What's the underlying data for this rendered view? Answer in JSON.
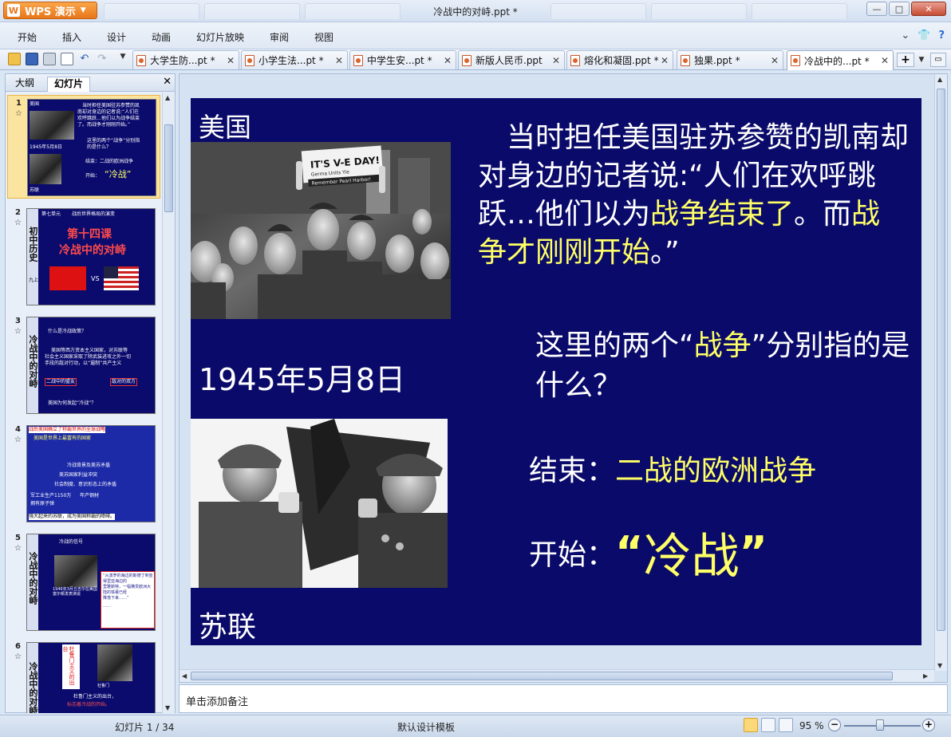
{
  "app": {
    "name": "WPS 演示",
    "window_title": "冷战中的对峙.ppt *",
    "controls": {
      "minimize": "—",
      "maximize": "□",
      "close": "✕"
    }
  },
  "menu": {
    "items": [
      "开始",
      "插入",
      "设计",
      "动画",
      "幻灯片放映",
      "审阅",
      "视图"
    ],
    "right_icons": [
      "chevron-down-icon",
      "shirt-icon",
      "help-icon"
    ]
  },
  "tabs": [
    {
      "label": "大学生防...pt *",
      "active": false
    },
    {
      "label": "小学生法...pt *",
      "active": false
    },
    {
      "label": "中学生安...pt *",
      "active": false
    },
    {
      "label": "新版人民币.ppt",
      "active": false
    },
    {
      "label": "熔化和凝固.ppt *",
      "active": false
    },
    {
      "label": "独果.ppt *",
      "active": false
    },
    {
      "label": "冷战中的...pt *",
      "active": true
    }
  ],
  "left_pane": {
    "tabs": [
      "大纲",
      "幻灯片"
    ],
    "active_tab": "幻灯片",
    "thumbnails": [
      {
        "num": "1",
        "lines": [
          "美国",
          "当时担任美国驻苏参赞的凯",
          "南却对身边的记者说:“人们在",
          "欢呼跳跃…他们以为战争结束",
          "了。而战争才刚刚开始。”",
          "1945年5月8日",
          "这里的两个“战争”分别指",
          "的是什么？",
          "结束：二战的欧洲战争",
          "开始：",
          "“冷战”",
          "苏联"
        ]
      },
      {
        "num": "2",
        "lines": [
          "初中历史",
          "第七单元",
          "战后世界格局的演变",
          "第十四课",
          "冷战中的对峙",
          "VS",
          "九上"
        ]
      },
      {
        "num": "3",
        "lines": [
          "冷战中的对峙",
          "什么是冷战政策？",
          "美国等西方资本主义国家，对苏联等",
          "社会主义国家采取了除武装进攻之外一切",
          "手段的敌对行动，以“遏制”共产主义",
          "二战中的盟友",
          "敌对的双方",
          "美国为何发起“冷战”？"
        ]
      },
      {
        "num": "4",
        "lines": [
          "战后美国确立了称霸世界的全球战略",
          "美国是世界上最富有的国家",
          "冷战背景及美苏矛盾",
          "美苏国家利益冲突",
          "社会制度、意识形态上的矛盾",
          "军工业生产1150万",
          "年产钢材",
          "拥有原子弹",
          "强大起来的苏联，成为美国称霸的障碍。"
        ]
      },
      {
        "num": "5",
        "lines": [
          "冷战中的对峙",
          "冷战的信号",
          "1946年3月丘吉尔在美国富尔顿发表演说",
          "“从波罗的海边的斯德丁到亚得里亚海边的",
          "里雅斯特，一幅横贯欧洲大陆的铁幕已经",
          "降落下来……”",
          "……"
        ]
      },
      {
        "num": "6",
        "lines": [
          "冷战中的对峙",
          "杜鲁门主义的出台",
          "杜鲁门",
          "杜鲁门主义的出台，",
          "标志着冷战的开始。"
        ]
      }
    ]
  },
  "slide": {
    "label_us": "美国",
    "quote_parts": [
      {
        "text": "　当时担任美国驻苏参赞的凯南却对身边的记者说:“人们在欢呼跳跃…他们以为",
        "hl": false
      },
      {
        "text": "战争结束了",
        "hl": true
      },
      {
        "text": "。而",
        "hl": false
      },
      {
        "text": "战争才刚刚开始",
        "hl": true
      },
      {
        "text": "。”",
        "hl": false
      }
    ],
    "date": "1945年5月8日",
    "question_parts": [
      {
        "text": "这里的两个“",
        "hl": false
      },
      {
        "text": "战争",
        "hl": true
      },
      {
        "text": "”分别指的是什么？",
        "hl": false
      }
    ],
    "end_label": "结束：",
    "end_value": "二战的欧洲战争",
    "start_label": "开始：",
    "start_value": "冷战",
    "start_quote_open": "“",
    "start_quote_close": "”",
    "label_ussr": "苏联",
    "newspaper_text": "IT'S V-E DAY!",
    "newspaper_sub1": "Germa Units Yie",
    "newspaper_sub2": "Remember Pearl Harbor!"
  },
  "notes": {
    "placeholder": "单击添加备注"
  },
  "status": {
    "slide_info": "幻灯片 1 / 34",
    "template": "默认设计模板",
    "zoom": "95 %",
    "zoom_minus": "−",
    "zoom_plus": "+",
    "zoom_level_percent": 95
  },
  "colors": {
    "slide_bg": "#0a0a6a",
    "highlight": "#ffff66",
    "app_orange": "#e8761a"
  }
}
